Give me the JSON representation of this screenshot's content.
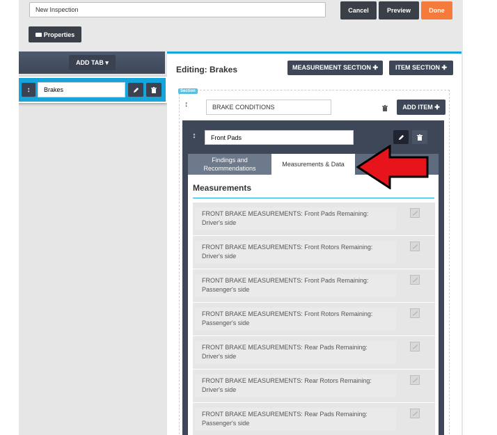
{
  "header": {
    "inspection_name": "New Inspection",
    "cancel_label": "Cancel",
    "preview_label": "Preview",
    "done_label": "Done",
    "properties_label": "Properties"
  },
  "sidebar": {
    "add_tab_label": "ADD TAB ▾",
    "tabs": [
      {
        "label": "Brakes"
      }
    ]
  },
  "editor": {
    "title": "Editing: Brakes",
    "measurement_section_label": "MEASUREMENT SECTION ✚",
    "item_section_label": "ITEM SECTION ✚",
    "section": {
      "tag": "Section",
      "name": "BRAKE CONDITIONS",
      "add_item_label": "ADD ITEM ✚",
      "item": {
        "name": "Front Pads",
        "tabs": [
          {
            "label": "Findings and Recommendations"
          },
          {
            "label": "Measurements & Data"
          }
        ],
        "measurements_title": "Measurements",
        "measurements": [
          "FRONT BRAKE MEASUREMENTS: Front Pads Remaining: Driver's side",
          "FRONT BRAKE MEASUREMENTS: Front Rotors Remaining: Driver's side",
          "FRONT BRAKE MEASUREMENTS: Front Pads Remaining: Passenger's side",
          "FRONT BRAKE MEASUREMENTS: Front Rotors Remaining: Passenger's side",
          "FRONT BRAKE MEASUREMENTS: Rear Pads Remaining: Driver's side",
          "FRONT BRAKE MEASUREMENTS: Rear Rotors Remaining: Driver's side",
          "FRONT BRAKE MEASUREMENTS: Rear Pads Remaining: Passenger's side"
        ]
      }
    }
  },
  "colors": {
    "accent": "#16a5db",
    "dark_button": "#3a3f48",
    "done_orange": "#f47b3b",
    "arrow_red": "#e8141c"
  },
  "icons": [
    "sort-handle-icon",
    "pencil-icon",
    "trash-icon",
    "image-placeholder-icon",
    "arrow-annotation-icon"
  ]
}
